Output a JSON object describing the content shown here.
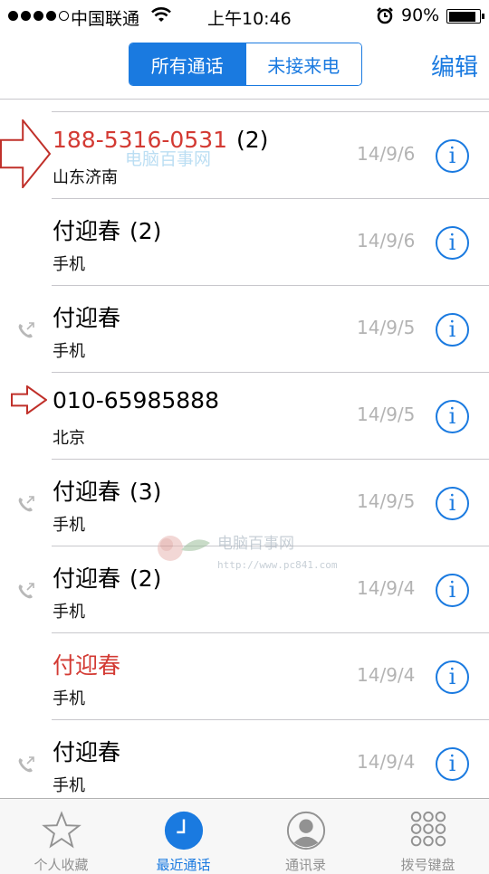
{
  "status": {
    "carrier": "中国联通",
    "time": "上午10:46",
    "battery": "90%",
    "battery_level": 0.9
  },
  "nav": {
    "segments": [
      "所有通话",
      "未接来电"
    ],
    "active_segment": 0,
    "edit": "编辑"
  },
  "calls": [
    {
      "name": "188-5316-0531",
      "count": "(2)",
      "sub": "山东济南",
      "date": "14/9/6",
      "missed": true,
      "outgoing": false
    },
    {
      "name": "付迎春",
      "count": "(2)",
      "sub": "手机",
      "date": "14/9/6",
      "missed": false,
      "outgoing": false
    },
    {
      "name": "付迎春",
      "count": "",
      "sub": "手机",
      "date": "14/9/5",
      "missed": false,
      "outgoing": true
    },
    {
      "name": "010-65985888",
      "count": "",
      "sub": "北京",
      "date": "14/9/5",
      "missed": false,
      "outgoing": false
    },
    {
      "name": "付迎春",
      "count": "(3)",
      "sub": "手机",
      "date": "14/9/5",
      "missed": false,
      "outgoing": true
    },
    {
      "name": "付迎春",
      "count": "(2)",
      "sub": "手机",
      "date": "14/9/4",
      "missed": false,
      "outgoing": true
    },
    {
      "name": "付迎春",
      "count": "",
      "sub": "手机",
      "date": "14/9/4",
      "missed": true,
      "outgoing": false
    },
    {
      "name": "付迎春",
      "count": "",
      "sub": "手机",
      "date": "14/9/4",
      "missed": false,
      "outgoing": true
    }
  ],
  "info_glyph": "i",
  "watermark": {
    "top": "电脑百事网",
    "middle": "电脑百事网",
    "url": "http://www.pc841.com"
  },
  "tabs": [
    {
      "label": "个人收藏",
      "icon": "star-icon"
    },
    {
      "label": "最近通话",
      "icon": "clock-icon"
    },
    {
      "label": "通讯录",
      "icon": "contact-icon"
    },
    {
      "label": "拨号键盘",
      "icon": "keypad-icon"
    }
  ],
  "active_tab": 1,
  "colors": {
    "accent": "#1a7ae0",
    "missed": "#d33a33",
    "date": "#b3b3b3",
    "annotation_arrow": "#c0302a"
  }
}
